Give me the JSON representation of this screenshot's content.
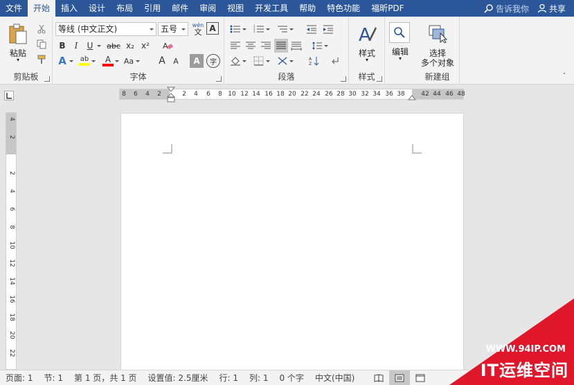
{
  "tabs": [
    "文件",
    "开始",
    "插入",
    "设计",
    "布局",
    "引用",
    "邮件",
    "审阅",
    "视图",
    "开发工具",
    "帮助",
    "特色功能",
    "福昕PDF"
  ],
  "active_tab": "开始",
  "tell_me": "告诉我你",
  "share": "共享",
  "clipboard": {
    "paste": "粘贴",
    "label": "剪贴板"
  },
  "font": {
    "name": "等线 (中文正文)",
    "size": "五号",
    "phonetic_top": "wén",
    "phonetic_bottom": "文",
    "char_border": "A",
    "bold": "B",
    "italic": "I",
    "underline": "U",
    "strike": "abc",
    "subscript": "x₂",
    "superscript": "x²",
    "text_effects": "A",
    "highlight": "ab",
    "font_color": "A",
    "grow": "A",
    "shrink": "A",
    "char_shading": "A",
    "enclose": "字",
    "label": "字体",
    "highlight_color": "#ffff00",
    "font_color_value": "#ff0000"
  },
  "paragraph": {
    "label": "段落"
  },
  "styles": {
    "button": "样式",
    "label": "样式"
  },
  "editing": {
    "button": "编辑"
  },
  "newgroup": {
    "line1": "选择",
    "line2": "多个对象",
    "label": "新建组"
  },
  "hruler_ticks": [
    "8",
    "6",
    "4",
    "2",
    "2",
    "4",
    "6",
    "8",
    "10",
    "12",
    "14",
    "16",
    "18",
    "20",
    "22",
    "24",
    "26",
    "28",
    "30",
    "32",
    "34",
    "36",
    "38",
    "42",
    "44",
    "46",
    "48"
  ],
  "vruler_ticks": [
    "4",
    "2",
    "2",
    "4",
    "6",
    "8",
    "10",
    "12",
    "14",
    "16",
    "18",
    "20",
    "22"
  ],
  "status": {
    "page": "页面: 1",
    "section": "节: 1",
    "pages": "第 1 页，共 1 页",
    "position": "设置值: 2.5厘米",
    "line": "行: 1",
    "column": "列: 1",
    "words": "0 个字",
    "language": "中文(中国)"
  },
  "watermark": {
    "url": "WWW.94IP.COM",
    "brand": "IT运维空间"
  },
  "colors": {
    "brand": "#2b579a",
    "watermark": "#e0162b"
  }
}
